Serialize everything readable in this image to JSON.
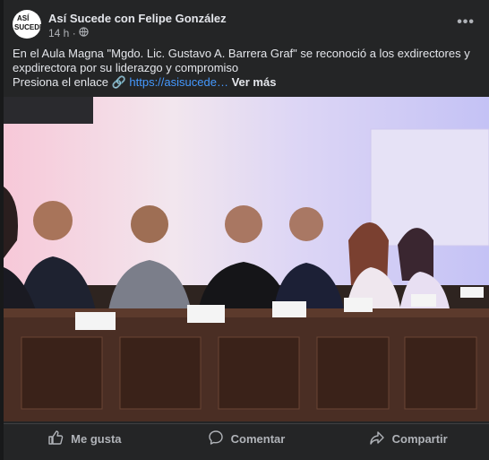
{
  "post": {
    "avatar_text_top": "ASÍ",
    "avatar_text_bottom": "SUCEDE",
    "author": "Así Sucede con Felipe González",
    "time": "14 h ·",
    "privacy_icon": "globe-icon",
    "more_label": "•••",
    "text_line1": "En el Aula Magna \"Mgdo. Lic. Gustavo A. Barrera Graf\" se reconoció a los exdirectores y",
    "text_line2": "expdirectora por su liderazgo y compromiso",
    "text_line3_prefix": "Presiona el enlace 🔗",
    "link_text": "https://asisucede…",
    "see_more": "Ver más"
  },
  "actions": {
    "like": "Me gusta",
    "comment": "Comentar",
    "share": "Compartir"
  },
  "colors": {
    "card_bg": "#242526",
    "text_primary": "#e4e6eb",
    "text_secondary": "#b0b3b8",
    "link": "#4599ff"
  }
}
